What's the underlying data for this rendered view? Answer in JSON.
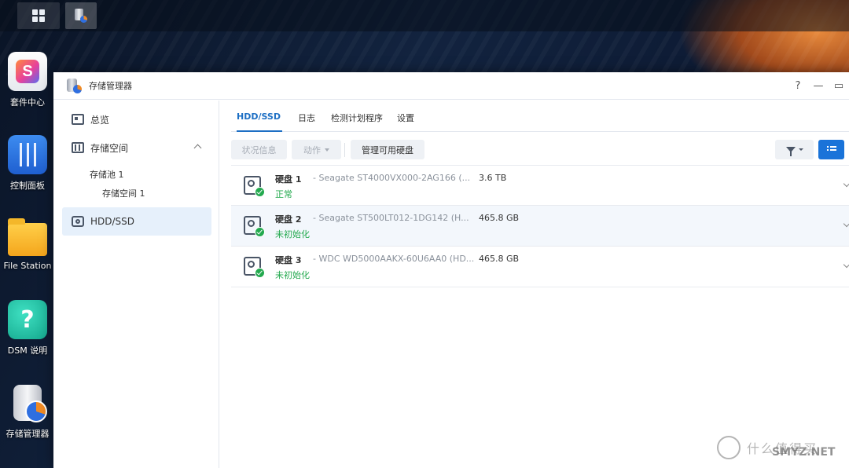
{
  "desktop": {
    "icons": [
      {
        "label": "套件中心"
      },
      {
        "label": "控制面板"
      },
      {
        "label": "File Station"
      },
      {
        "label": "DSM 说明"
      },
      {
        "label": "存储管理器"
      }
    ]
  },
  "window": {
    "title": "存储管理器",
    "help": "?",
    "minimize": "—",
    "maximize": "▭"
  },
  "sidebar": {
    "items": [
      {
        "label": "总览"
      },
      {
        "label": "存储空间"
      },
      {
        "label": "HDD/SSD"
      }
    ],
    "sub_items": [
      {
        "label": "存储池 1"
      },
      {
        "label": "存储空间 1"
      }
    ]
  },
  "tabs": [
    {
      "label": "HDD/SSD",
      "active": true
    },
    {
      "label": "日志"
    },
    {
      "label": "检测计划程序"
    },
    {
      "label": "设置"
    }
  ],
  "toolbar": {
    "status_info": "状况信息",
    "action": "动作",
    "manage_available": "管理可用硬盘"
  },
  "disks": [
    {
      "name": "硬盘 1",
      "model": "- Seagate ST4000VX000-2AG166 (...",
      "size": "3.6 TB",
      "status": "正常"
    },
    {
      "name": "硬盘 2",
      "model": "- Seagate ST500LT012-1DG142 (H...",
      "size": "465.8 GB",
      "status": "未初始化"
    },
    {
      "name": "硬盘 3",
      "model": "- WDC WD5000AAKX-60U6AA0 (HD...",
      "size": "465.8 GB",
      "status": "未初始化"
    }
  ],
  "watermark": {
    "text": "什么值得买",
    "sub": "SMYZ.NET"
  },
  "colors": {
    "accent": "#1a73d9",
    "status_ok": "#23a94e"
  }
}
